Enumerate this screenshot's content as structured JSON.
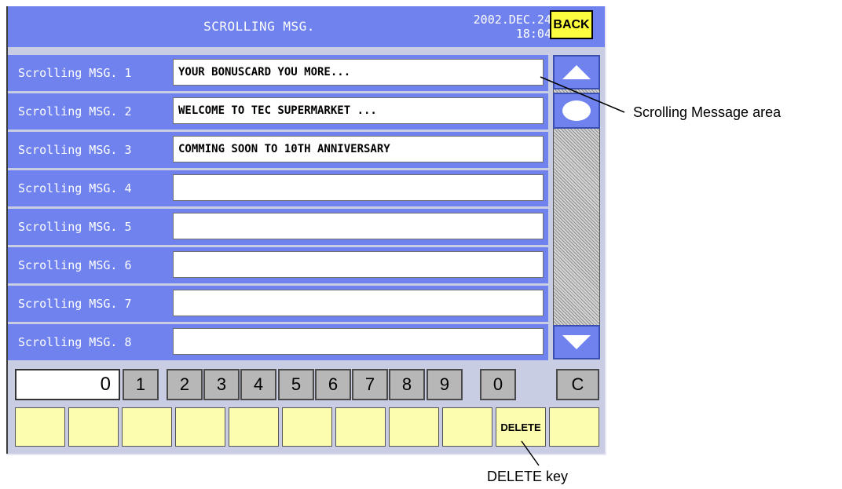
{
  "header": {
    "title": "SCROLLING MSG.",
    "date": "2002.DEC.24",
    "time": "18:04",
    "back_label": "BACK"
  },
  "messages": [
    {
      "label": "Scrolling MSG. 1",
      "value": "YOUR BONUSCARD YOU MORE..."
    },
    {
      "label": "Scrolling MSG. 2",
      "value": "WELCOME TO TEC SUPERMARKET ..."
    },
    {
      "label": "Scrolling MSG. 3",
      "value": "COMMING SOON TO 10TH ANNIVERSARY"
    },
    {
      "label": "Scrolling MSG. 4",
      "value": ""
    },
    {
      "label": "Scrolling MSG. 5",
      "value": ""
    },
    {
      "label": "Scrolling MSG. 6",
      "value": ""
    },
    {
      "label": "Scrolling MSG. 7",
      "value": ""
    },
    {
      "label": "Scrolling MSG. 8",
      "value": ""
    }
  ],
  "keypad": {
    "display": "0",
    "keys": [
      "1",
      "2",
      "3",
      "4",
      "5",
      "6",
      "7",
      "8",
      "9",
      "0",
      "C"
    ]
  },
  "function_keys": {
    "delete_label": "DELETE"
  },
  "callouts": {
    "scroll_area": "Scrolling Message area",
    "delete_key": "DELETE key"
  },
  "colors": {
    "header": "#6f82ed",
    "back_button": "#fdfd3f",
    "function_key": "#fdfdb0",
    "number_key": "#b7b7b7"
  },
  "icons": [
    "scroll-up-icon",
    "scroll-thumb-icon",
    "scroll-down-icon"
  ]
}
